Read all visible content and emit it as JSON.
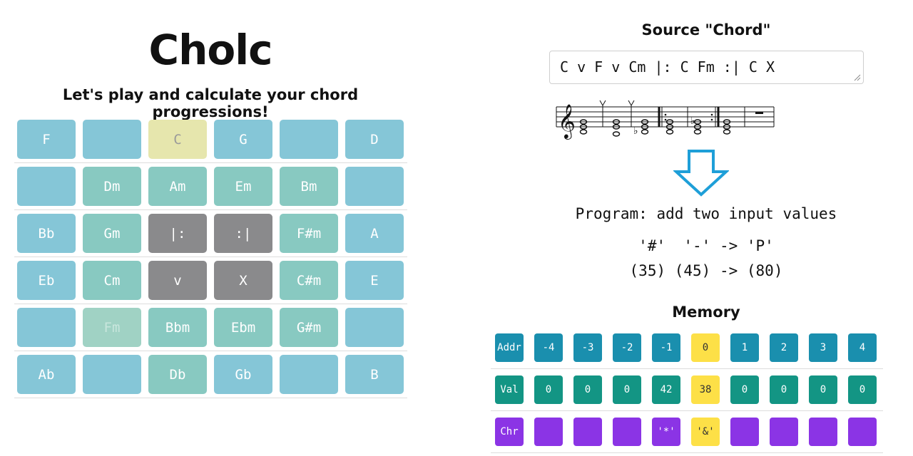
{
  "app": {
    "title": "Cholc",
    "subtitle": "Let's play and calculate your chord progressions!"
  },
  "chord_grid": {
    "rows": [
      [
        {
          "label": "F",
          "style": "blue"
        },
        {
          "label": "",
          "style": "blue"
        },
        {
          "label": "C",
          "style": "yellow"
        },
        {
          "label": "G",
          "style": "blue"
        },
        {
          "label": "",
          "style": "blue"
        },
        {
          "label": "D",
          "style": "blue"
        }
      ],
      [
        {
          "label": "",
          "style": "blue"
        },
        {
          "label": "Dm",
          "style": "teal"
        },
        {
          "label": "Am",
          "style": "teal"
        },
        {
          "label": "Em",
          "style": "teal"
        },
        {
          "label": "Bm",
          "style": "teal"
        },
        {
          "label": "",
          "style": "blue"
        }
      ],
      [
        {
          "label": "Bb",
          "style": "blue"
        },
        {
          "label": "Gm",
          "style": "teal"
        },
        {
          "label": "|:",
          "style": "gray"
        },
        {
          "label": ":|",
          "style": "gray"
        },
        {
          "label": "F#m",
          "style": "teal"
        },
        {
          "label": "A",
          "style": "blue"
        }
      ],
      [
        {
          "label": "Eb",
          "style": "blue"
        },
        {
          "label": "Cm",
          "style": "teal"
        },
        {
          "label": "v",
          "style": "gray"
        },
        {
          "label": "X",
          "style": "gray"
        },
        {
          "label": "C#m",
          "style": "teal"
        },
        {
          "label": "E",
          "style": "blue"
        }
      ],
      [
        {
          "label": "",
          "style": "blue"
        },
        {
          "label": "Fm",
          "style": "faded"
        },
        {
          "label": "Bbm",
          "style": "teal"
        },
        {
          "label": "Ebm",
          "style": "teal"
        },
        {
          "label": "G#m",
          "style": "teal"
        },
        {
          "label": "",
          "style": "blue"
        }
      ],
      [
        {
          "label": "Ab",
          "style": "blue"
        },
        {
          "label": "",
          "style": "blue"
        },
        {
          "label": "Db",
          "style": "teal"
        },
        {
          "label": "Gb",
          "style": "blue"
        },
        {
          "label": "",
          "style": "blue"
        },
        {
          "label": "B",
          "style": "blue"
        }
      ]
    ]
  },
  "source": {
    "heading": "Source \"Chord\"",
    "value": "C v F v Cm |: C Fm :| C X"
  },
  "icons": {
    "staff": "music-staff-icon",
    "arrow": "down-arrow-icon",
    "grip": "resize-grip-icon"
  },
  "program": {
    "description": "Program: add two input values",
    "io_chars": "'#'  '-' -> 'P'",
    "io_nums": "(35) (45) -> (80)"
  },
  "memory": {
    "heading": "Memory",
    "rows": [
      {
        "header": "Addr",
        "type": "addr",
        "cells": [
          {
            "text": "-4"
          },
          {
            "text": "-3"
          },
          {
            "text": "-2"
          },
          {
            "text": "-1"
          },
          {
            "text": "0",
            "highlight": true
          },
          {
            "text": "1"
          },
          {
            "text": "2"
          },
          {
            "text": "3"
          },
          {
            "text": "4"
          }
        ]
      },
      {
        "header": "Val",
        "type": "val",
        "cells": [
          {
            "text": "0"
          },
          {
            "text": "0"
          },
          {
            "text": "0"
          },
          {
            "text": "42"
          },
          {
            "text": "38",
            "highlight": true
          },
          {
            "text": "0"
          },
          {
            "text": "0"
          },
          {
            "text": "0"
          },
          {
            "text": "0"
          }
        ]
      },
      {
        "header": "Chr",
        "type": "chr",
        "cells": [
          {
            "text": ""
          },
          {
            "text": ""
          },
          {
            "text": ""
          },
          {
            "text": "'*'"
          },
          {
            "text": "'&'",
            "highlight": true
          },
          {
            "text": ""
          },
          {
            "text": ""
          },
          {
            "text": ""
          },
          {
            "text": ""
          }
        ]
      }
    ]
  },
  "colors": {
    "pad_blue": "#85c6d7",
    "pad_teal": "#88c9c1",
    "pad_gray": "#8a8a8c",
    "pad_yellow": "#e6e6ad",
    "mem_addr": "#1a8fae",
    "mem_val": "#139584",
    "mem_chr": "#8b34e5",
    "highlight": "#fde047",
    "arrow": "#1e9fd8"
  }
}
